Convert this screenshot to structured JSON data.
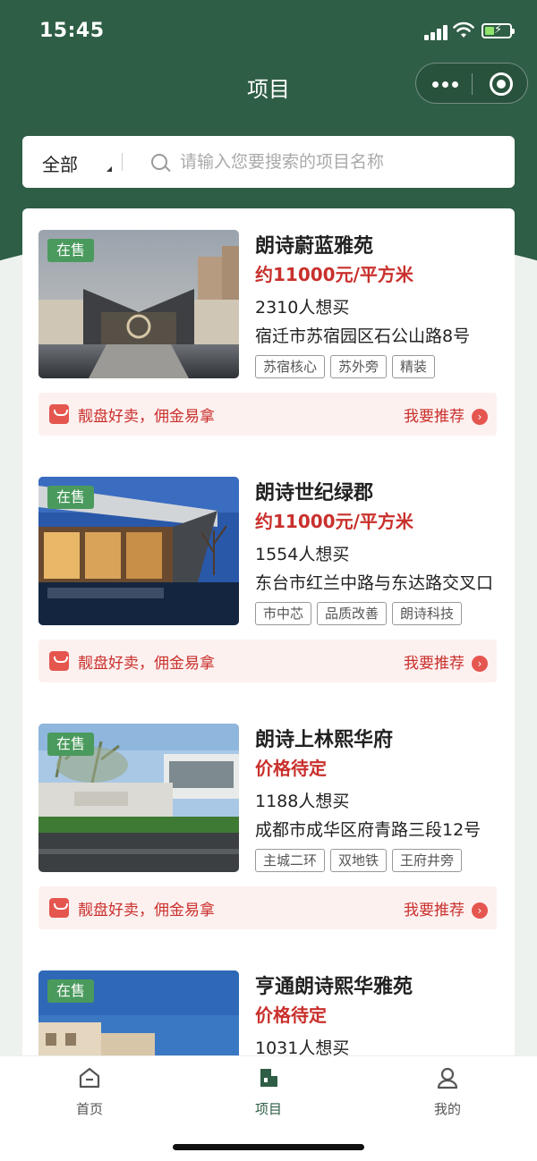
{
  "status_bar": {
    "time": "15:45"
  },
  "nav": {
    "title": "项目"
  },
  "search": {
    "filter_label": "全部",
    "placeholder": "请输入您要搜索的项目名称"
  },
  "projects": [
    {
      "badge": "在售",
      "title": "朗诗蔚蓝雅苑",
      "price": "约11000元/平方米",
      "wants": "2310人想买",
      "address": "宿迁市苏宿园区石公山路8号",
      "tags": [
        "苏宿核心",
        "苏外旁",
        "精装"
      ],
      "promo_text": "靓盘好卖，佣金易拿",
      "promo_link": "我要推荐"
    },
    {
      "badge": "在售",
      "title": "朗诗世纪绿郡",
      "price": "约11000元/平方米",
      "wants": "1554人想买",
      "address": "东台市红兰中路与东达路交叉口",
      "tags": [
        "市中芯",
        "品质改善",
        "朗诗科技"
      ],
      "promo_text": "靓盘好卖，佣金易拿",
      "promo_link": "我要推荐"
    },
    {
      "badge": "在售",
      "title": "朗诗上林熙华府",
      "price": "价格待定",
      "wants": "1188人想买",
      "address": "成都市成华区府青路三段12号",
      "tags": [
        "主城二环",
        "双地铁",
        "王府井旁"
      ],
      "promo_text": "靓盘好卖，佣金易拿",
      "promo_link": "我要推荐"
    },
    {
      "badge": "在售",
      "title": "亨通朗诗熙华雅苑",
      "price": "价格待定",
      "wants": "1031人想买"
    }
  ],
  "tabs": [
    {
      "label": "首页",
      "icon": "home-icon",
      "active": false
    },
    {
      "label": "项目",
      "icon": "building-icon",
      "active": true
    },
    {
      "label": "我的",
      "icon": "user-icon",
      "active": false
    }
  ],
  "colors": {
    "brand_green": "#2e5e45",
    "price_red": "#c9302c",
    "active_tab": "#2e5e45",
    "badge_green": "#4a9a5d"
  }
}
